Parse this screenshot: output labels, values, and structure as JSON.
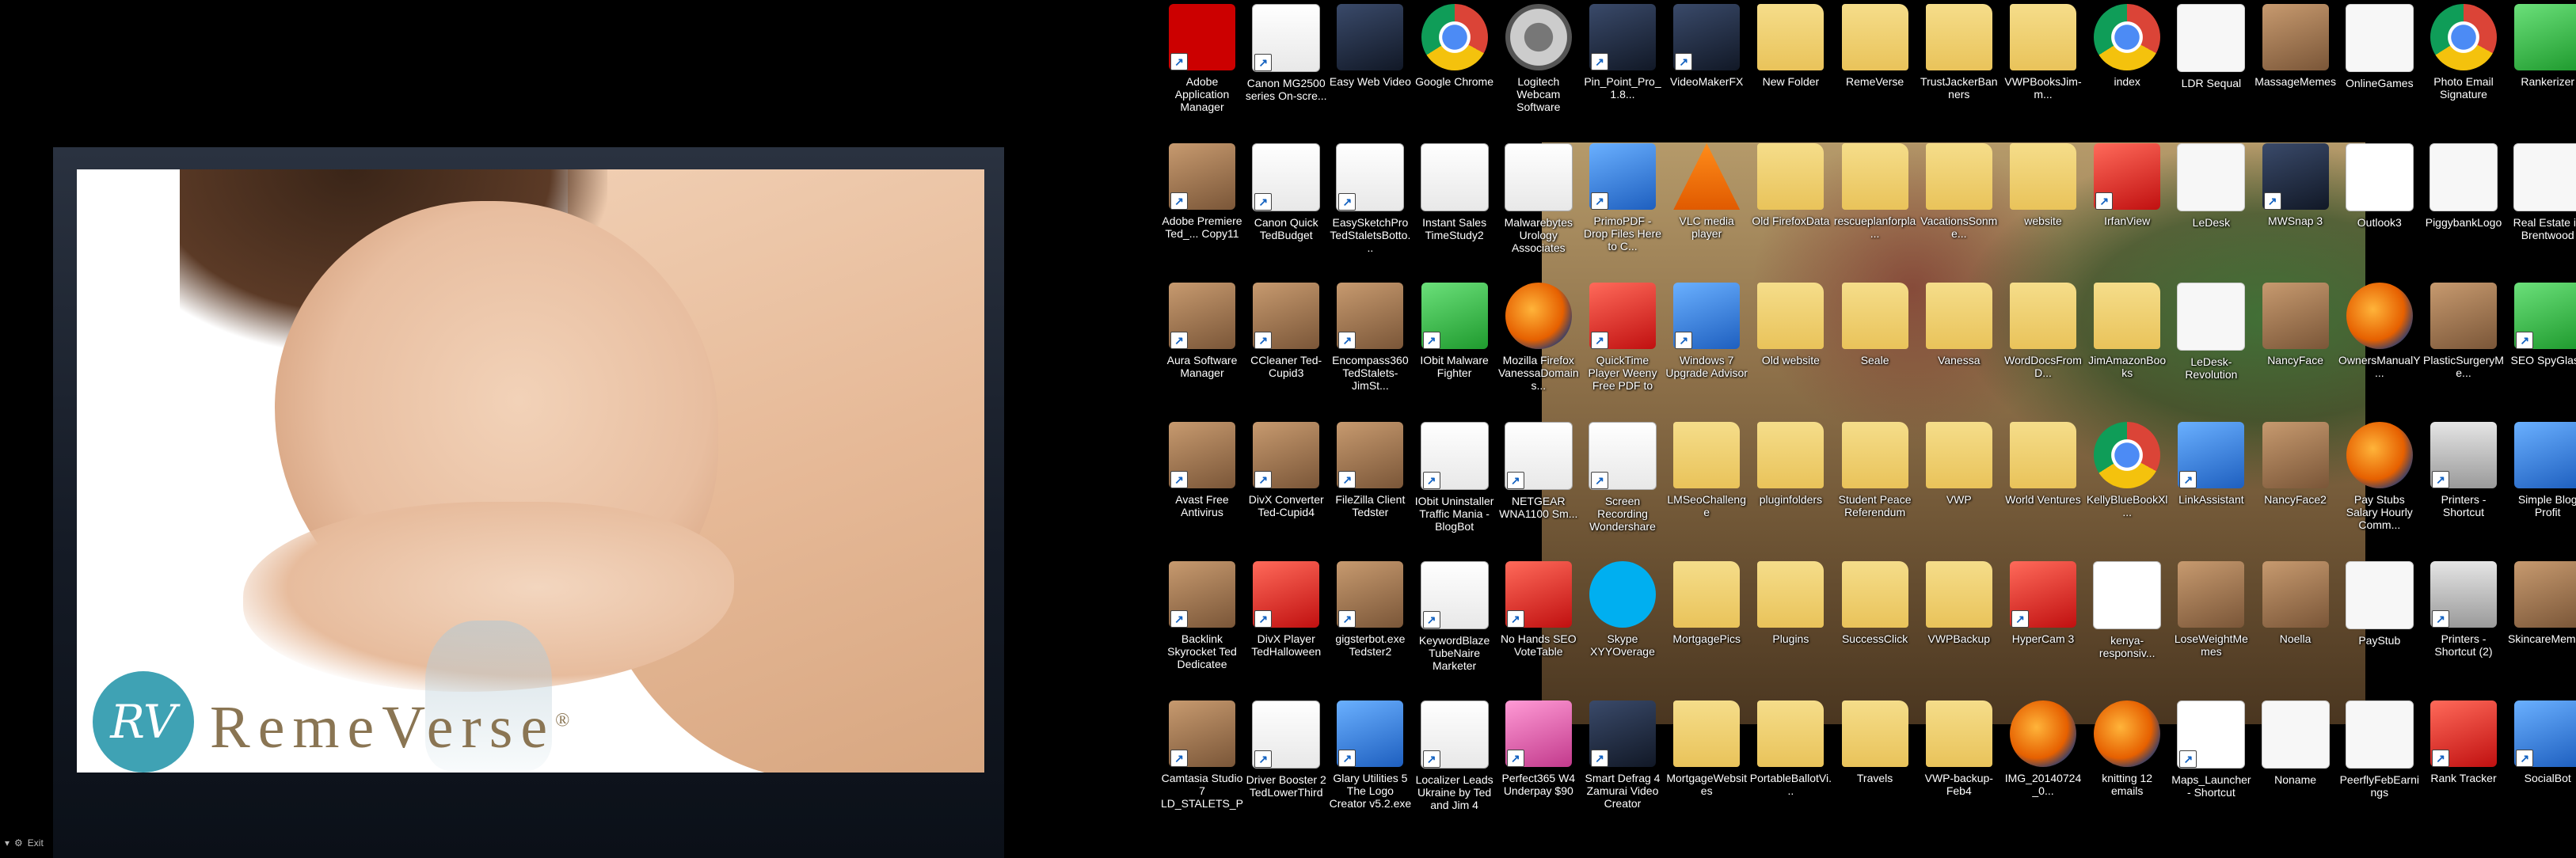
{
  "left_monitor": {
    "brand_initials": "RV",
    "brand_name": "RemeVerse",
    "brand_mark": "®",
    "viewer_controls": [
      "▾",
      "⚙",
      "Exit"
    ]
  },
  "colors": {
    "brand_teal": "#3fa2b4",
    "brand_text": "#8a7553",
    "desktop_label": "#ffffff"
  },
  "desktop_icons": [
    {
      "label": "Adobe Application Manager",
      "icon": "adobe-icon",
      "kind": "adobe",
      "shortcut": true
    },
    {
      "label": "Canon MG2500 series On-scre...",
      "icon": "help-document-icon",
      "kind": "doc",
      "shortcut": true
    },
    {
      "label": "Easy Web Video",
      "icon": "video-robot-icon",
      "kind": "dark",
      "shortcut": false
    },
    {
      "label": "Google Chrome",
      "icon": "chrome-icon",
      "kind": "chrome",
      "shortcut": false
    },
    {
      "label": "Logitech Webcam Software",
      "icon": "webcam-icon",
      "kind": "webcam",
      "shortcut": false
    },
    {
      "label": "Pin_Point_Pro_1.8...",
      "icon": "pinpoint-icon",
      "kind": "dark",
      "shortcut": true
    },
    {
      "label": "VideoMakerFX",
      "icon": "videomaker-icon",
      "kind": "dark",
      "shortcut": true
    },
    {
      "label": "New Folder",
      "icon": "folder-icon",
      "kind": "folder",
      "shortcut": false
    },
    {
      "label": "RemeVerse",
      "icon": "folder-icon",
      "kind": "folder",
      "shortcut": false
    },
    {
      "label": "TrustJackerBanners",
      "icon": "folder-icon",
      "kind": "folder",
      "shortcut": false
    },
    {
      "label": "VWPBooksJim-m...",
      "icon": "folder-icon",
      "kind": "folder",
      "shortcut": false
    },
    {
      "label": "index",
      "icon": "chrome-icon",
      "kind": "chrome",
      "shortcut": false
    },
    {
      "label": "LDR Sequal",
      "icon": "document-icon",
      "kind": "whitepage",
      "shortcut": false
    },
    {
      "label": "MassageMemes",
      "icon": "photo-icon",
      "kind": "photo",
      "shortcut": false
    },
    {
      "label": "OnlineGames",
      "icon": "document-icon",
      "kind": "whitepage",
      "shortcut": false
    },
    {
      "label": "Photo Email Signature",
      "icon": "chrome-icon",
      "kind": "chrome",
      "shortcut": false
    },
    {
      "label": "Rankerizer",
      "icon": "rankerizer-icon",
      "kind": "green",
      "shortcut": false
    },
    {
      "label": "Adobe Premiere Ted_... Copy11",
      "icon": "photo-icon",
      "kind": "photo",
      "shortcut": true
    },
    {
      "label": "Canon Quick TedBudget",
      "icon": "document-icon",
      "kind": "doc",
      "shortcut": true
    },
    {
      "label": "EasySketchPro TedStaletsBotto...",
      "icon": "document-icon",
      "kind": "doc",
      "shortcut": true
    },
    {
      "label": "Instant Sales TimeStudy2",
      "icon": "document-icon",
      "kind": "doc",
      "shortcut": false
    },
    {
      "label": "Malwarebytes Urology Associates",
      "icon": "document-icon",
      "kind": "doc",
      "shortcut": false
    },
    {
      "label": "PrimoPDF - Drop Files Here to C...",
      "icon": "primopdf-icon",
      "kind": "app",
      "shortcut": true
    },
    {
      "label": "VLC media player",
      "icon": "vlc-icon",
      "kind": "vlc",
      "shortcut": false
    },
    {
      "label": "Old FirefoxData",
      "icon": "folder-icon",
      "kind": "folder",
      "shortcut": false
    },
    {
      "label": "rescueplanforpla...",
      "icon": "folder-icon",
      "kind": "folder",
      "shortcut": false
    },
    {
      "label": "VacationsSonme...",
      "icon": "folder-icon",
      "kind": "folder",
      "shortcut": false
    },
    {
      "label": "website",
      "icon": "folder-icon",
      "kind": "folder",
      "shortcut": false
    },
    {
      "label": "IrfanView",
      "icon": "irfanview-icon",
      "kind": "red",
      "shortcut": true
    },
    {
      "label": "LeDesk",
      "icon": "document-icon",
      "kind": "whitepage",
      "shortcut": false
    },
    {
      "label": "MWSnap 3",
      "icon": "camera-icon",
      "kind": "dark",
      "shortcut": true
    },
    {
      "label": "Outlook3",
      "icon": "document-icon",
      "kind": "blank",
      "shortcut": false
    },
    {
      "label": "PiggybankLogo",
      "icon": "photo-icon",
      "kind": "whitepage",
      "shortcut": false
    },
    {
      "label": "Real Estate in Brentwood",
      "icon": "document-icon",
      "kind": "whitepage",
      "shortcut": false
    },
    {
      "label": "Aura Software Manager",
      "icon": "photo-icon",
      "kind": "photo",
      "shortcut": true
    },
    {
      "label": "CCleaner Ted-Cupid3",
      "icon": "photo-icon",
      "kind": "photo",
      "shortcut": true
    },
    {
      "label": "Encompass360 TedStalets-JimSt...",
      "icon": "photo-icon",
      "kind": "photo",
      "shortcut": true
    },
    {
      "label": "IObit Malware Fighter",
      "icon": "excel-icon",
      "kind": "green",
      "shortcut": true
    },
    {
      "label": "Mozilla Firefox VanessaDomains...",
      "icon": "firefox-icon",
      "kind": "firefox",
      "shortcut": false
    },
    {
      "label": "QuickTime Player Weeny Free PDF to Image Converter",
      "icon": "converter-icon",
      "kind": "red",
      "shortcut": true
    },
    {
      "label": "Windows 7 Upgrade Advisor",
      "icon": "windows-icon",
      "kind": "app",
      "shortcut": true
    },
    {
      "label": "Old website",
      "icon": "folder-icon",
      "kind": "folder",
      "shortcut": false
    },
    {
      "label": "Seale",
      "icon": "folder-icon",
      "kind": "folder",
      "shortcut": false
    },
    {
      "label": "Vanessa",
      "icon": "folder-icon",
      "kind": "folder",
      "shortcut": false
    },
    {
      "label": "WordDocsFromD...",
      "icon": "folder-icon",
      "kind": "folder",
      "shortcut": false
    },
    {
      "label": "JimAmazonBooks",
      "icon": "folder-icon",
      "kind": "folder",
      "shortcut": false
    },
    {
      "label": "LeDesk-Revolution",
      "icon": "document-icon",
      "kind": "whitepage",
      "shortcut": false
    },
    {
      "label": "NancyFace",
      "icon": "photo-icon",
      "kind": "photo",
      "shortcut": false
    },
    {
      "label": "OwnersManualY...",
      "icon": "firefox-icon",
      "kind": "firefox",
      "shortcut": false
    },
    {
      "label": "PlasticSurgeryMe...",
      "icon": "photo-icon",
      "kind": "photo",
      "shortcut": false
    },
    {
      "label": "SEO SpyGlass",
      "icon": "spyglass-icon",
      "kind": "green",
      "shortcut": true
    },
    {
      "label": "Avast Free Antivirus",
      "icon": "photo-icon",
      "kind": "photo",
      "shortcut": true
    },
    {
      "label": "DivX Converter Ted-Cupid4",
      "icon": "photo-icon",
      "kind": "photo",
      "shortcut": true
    },
    {
      "label": "FileZilla Client Tedster",
      "icon": "photo-icon",
      "kind": "photo",
      "shortcut": true
    },
    {
      "label": "IObit Uninstaller Traffic Mania - BlogBot",
      "icon": "document-icon",
      "kind": "doc",
      "shortcut": true
    },
    {
      "label": "NETGEAR WNA1100 Sm...",
      "icon": "document-icon",
      "kind": "doc",
      "shortcut": true
    },
    {
      "label": "Screen Recording Wondershare Video Stub...",
      "icon": "document-icon",
      "kind": "doc",
      "shortcut": true
    },
    {
      "label": "LMSeoChallenge",
      "icon": "folder-icon",
      "kind": "folder",
      "shortcut": false
    },
    {
      "label": "pluginfolders",
      "icon": "folder-icon",
      "kind": "folder",
      "shortcut": false
    },
    {
      "label": "Student Peace Referendum",
      "icon": "folder-icon",
      "kind": "folder",
      "shortcut": false
    },
    {
      "label": "VWP",
      "icon": "folder-icon",
      "kind": "folder",
      "shortcut": false
    },
    {
      "label": "World Ventures",
      "icon": "folder-icon",
      "kind": "folder",
      "shortcut": false
    },
    {
      "label": "KellyBlueBookXl...",
      "icon": "chrome-icon",
      "kind": "chrome",
      "shortcut": false
    },
    {
      "label": "LinkAssistant",
      "icon": "linkassistant-icon",
      "kind": "app",
      "shortcut": true
    },
    {
      "label": "NancyFace2",
      "icon": "photo-icon",
      "kind": "photo",
      "shortcut": false
    },
    {
      "label": "Pay Stubs Salary Hourly Comm...",
      "icon": "firefox-icon",
      "kind": "firefox",
      "shortcut": false
    },
    {
      "label": "Printers - Shortcut",
      "icon": "printer-icon",
      "kind": "printer",
      "shortcut": true
    },
    {
      "label": "Simple Blog Profit",
      "icon": "document-icon",
      "kind": "app",
      "shortcut": false
    },
    {
      "label": "Backlink Skyrocket Ted Dedicatee",
      "icon": "photo-icon",
      "kind": "photo",
      "shortcut": true
    },
    {
      "label": "DivX Player TedHalloween",
      "icon": "photo-icon",
      "kind": "red",
      "shortcut": true
    },
    {
      "label": "gigsterbot.exe Tedster2",
      "icon": "photo-icon",
      "kind": "photo",
      "shortcut": true
    },
    {
      "label": "KeywordBlaze TubeNaire Marketer",
      "icon": "document-icon",
      "kind": "doc",
      "shortcut": true
    },
    {
      "label": "No Hands SEO VoteTable",
      "icon": "no-icon",
      "kind": "red",
      "shortcut": true
    },
    {
      "label": "Skype XYYOverage",
      "icon": "skype-icon",
      "kind": "skype",
      "shortcut": false
    },
    {
      "label": "MortgagePics",
      "icon": "folder-icon",
      "kind": "folder",
      "shortcut": false
    },
    {
      "label": "Plugins",
      "icon": "folder-icon",
      "kind": "folder",
      "shortcut": false
    },
    {
      "label": "SuccessClick",
      "icon": "folder-icon",
      "kind": "folder",
      "shortcut": false
    },
    {
      "label": "VWPBackup",
      "icon": "folder-icon",
      "kind": "folder",
      "shortcut": false
    },
    {
      "label": "HyperCam 3",
      "icon": "hypercam-icon",
      "kind": "red",
      "shortcut": true
    },
    {
      "label": "kenya-responsiv...",
      "icon": "document-icon",
      "kind": "blank",
      "shortcut": false
    },
    {
      "label": "LoseWeightMemes",
      "icon": "photo-icon",
      "kind": "photo",
      "shortcut": false
    },
    {
      "label": "Noella",
      "icon": "photo-icon",
      "kind": "photo",
      "shortcut": false
    },
    {
      "label": "PayStub",
      "icon": "spreadsheet-icon",
      "kind": "whitepage",
      "shortcut": false
    },
    {
      "label": "Printers - Shortcut (2)",
      "icon": "printer-icon",
      "kind": "printer",
      "shortcut": true
    },
    {
      "label": "SkincareMemes",
      "icon": "photo-icon",
      "kind": "photo",
      "shortcut": false
    },
    {
      "label": "Camtasia Studio 7 LD_STALETS_P...",
      "icon": "photo-icon",
      "kind": "photo",
      "shortcut": true
    },
    {
      "label": "Driver Booster 2 TedLowerThird",
      "icon": "document-icon",
      "kind": "doc",
      "shortcut": true
    },
    {
      "label": "Glary Utilities 5 The Logo Creator v5.2.exe",
      "icon": "logocreator-icon",
      "kind": "app",
      "shortcut": true
    },
    {
      "label": "Localizer Leads Ukraine by Ted and Jim 4",
      "icon": "document-icon",
      "kind": "doc",
      "shortcut": true
    },
    {
      "label": "Perfect365 W4 Underpay $90",
      "icon": "perfect365-icon",
      "kind": "pink",
      "shortcut": true
    },
    {
      "label": "Smart Defrag 4 Zamurai Video Creator",
      "icon": "defrag-icon",
      "kind": "dark",
      "shortcut": true
    },
    {
      "label": "MortgageWebsites",
      "icon": "folder-icon",
      "kind": "folder",
      "shortcut": false
    },
    {
      "label": "PortableBallotVi...",
      "icon": "folder-icon",
      "kind": "folder",
      "shortcut": false
    },
    {
      "label": "Travels",
      "icon": "folder-icon",
      "kind": "folder",
      "shortcut": false
    },
    {
      "label": "VWP-backup-Feb4",
      "icon": "folder-icon",
      "kind": "folder",
      "shortcut": false
    },
    {
      "label": "IMG_20140724_0...",
      "icon": "firefox-icon",
      "kind": "firefox",
      "shortcut": false
    },
    {
      "label": "knitting 12 emails",
      "icon": "firefox-icon",
      "kind": "firefox",
      "shortcut": false
    },
    {
      "label": "Maps_Launcher - Shortcut",
      "icon": "document-icon",
      "kind": "blank",
      "shortcut": true
    },
    {
      "label": "Noname",
      "icon": "document-icon",
      "kind": "whitepage",
      "shortcut": false
    },
    {
      "label": "PeerflyFebEarnings",
      "icon": "document-icon",
      "kind": "whitepage",
      "shortcut": false
    },
    {
      "label": "Rank Tracker",
      "icon": "ranktracker-icon",
      "kind": "red",
      "shortcut": true
    },
    {
      "label": "SocialBot",
      "icon": "socialbot-icon",
      "kind": "app",
      "shortcut": true
    }
  ]
}
